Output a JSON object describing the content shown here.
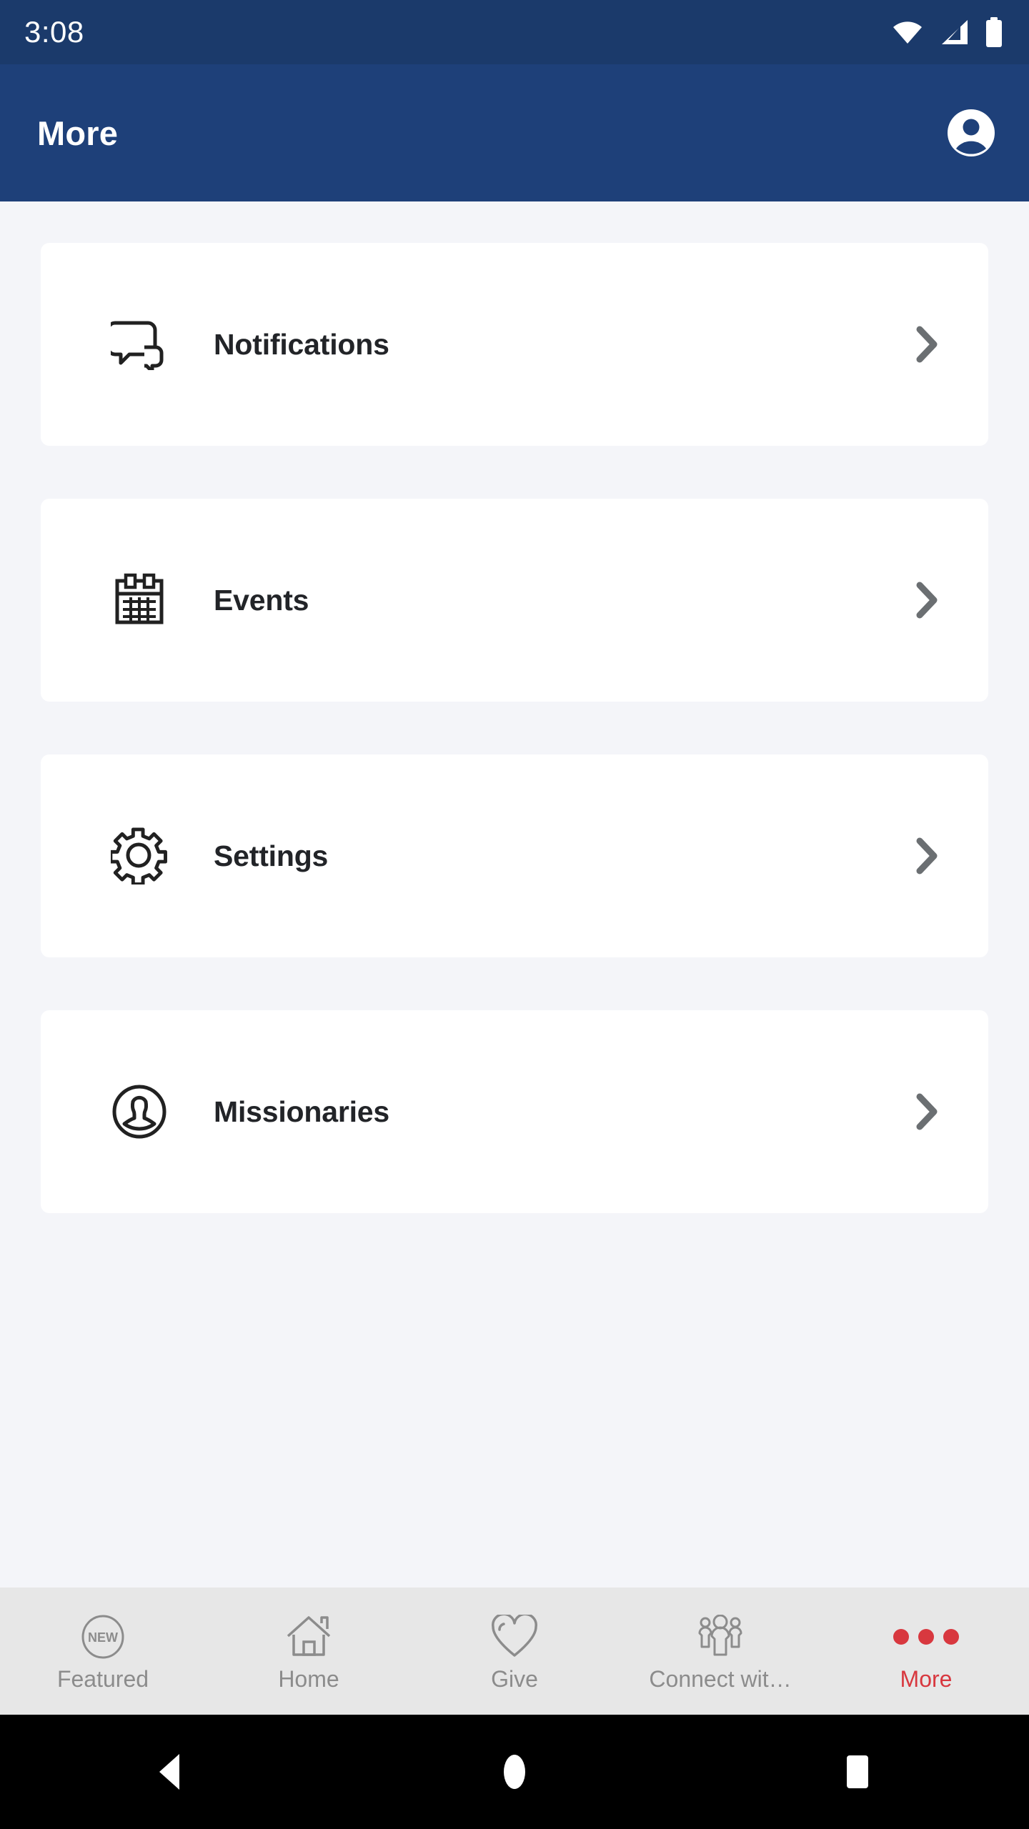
{
  "status_bar": {
    "time": "3:08",
    "icons": [
      "wifi-icon",
      "cellular-signal-icon",
      "battery-icon"
    ]
  },
  "app_bar": {
    "title": "More",
    "avatar_icon": "account-circle-icon"
  },
  "colors": {
    "status_bar_bg": "#1B3A6B",
    "app_bar_bg": "#1E4079",
    "page_bg": "#F4F5F9",
    "card_bg": "#FFFFFF",
    "card_text": "#222428",
    "chevron": "#6B6F72",
    "tab_bar_bg": "#E7E7E7",
    "tab_inactive": "#8C8C8C",
    "tab_active": "#D8383F",
    "nav_bar_bg": "#000000"
  },
  "menu": {
    "items": [
      {
        "label": "Notifications",
        "icon": "chat-bubbles-icon",
        "chevron": "chevron-right-icon"
      },
      {
        "label": "Events",
        "icon": "calendar-icon",
        "chevron": "chevron-right-icon"
      },
      {
        "label": "Settings",
        "icon": "gear-icon",
        "chevron": "chevron-right-icon"
      },
      {
        "label": "Missionaries",
        "icon": "person-circle-icon",
        "chevron": "chevron-right-icon"
      }
    ]
  },
  "tab_bar": {
    "items": [
      {
        "label": "Featured",
        "icon": "new-badge-icon",
        "active": false
      },
      {
        "label": "Home",
        "icon": "home-icon",
        "active": false
      },
      {
        "label": "Give",
        "icon": "heart-icon",
        "active": false
      },
      {
        "label": "Connect wit…",
        "icon": "people-group-icon",
        "active": false
      },
      {
        "label": "More",
        "icon": "three-dots-icon",
        "active": true
      }
    ],
    "featured_badge_text": "NEW"
  },
  "android_nav": {
    "buttons": [
      "back-button",
      "home-button",
      "recents-button"
    ]
  }
}
